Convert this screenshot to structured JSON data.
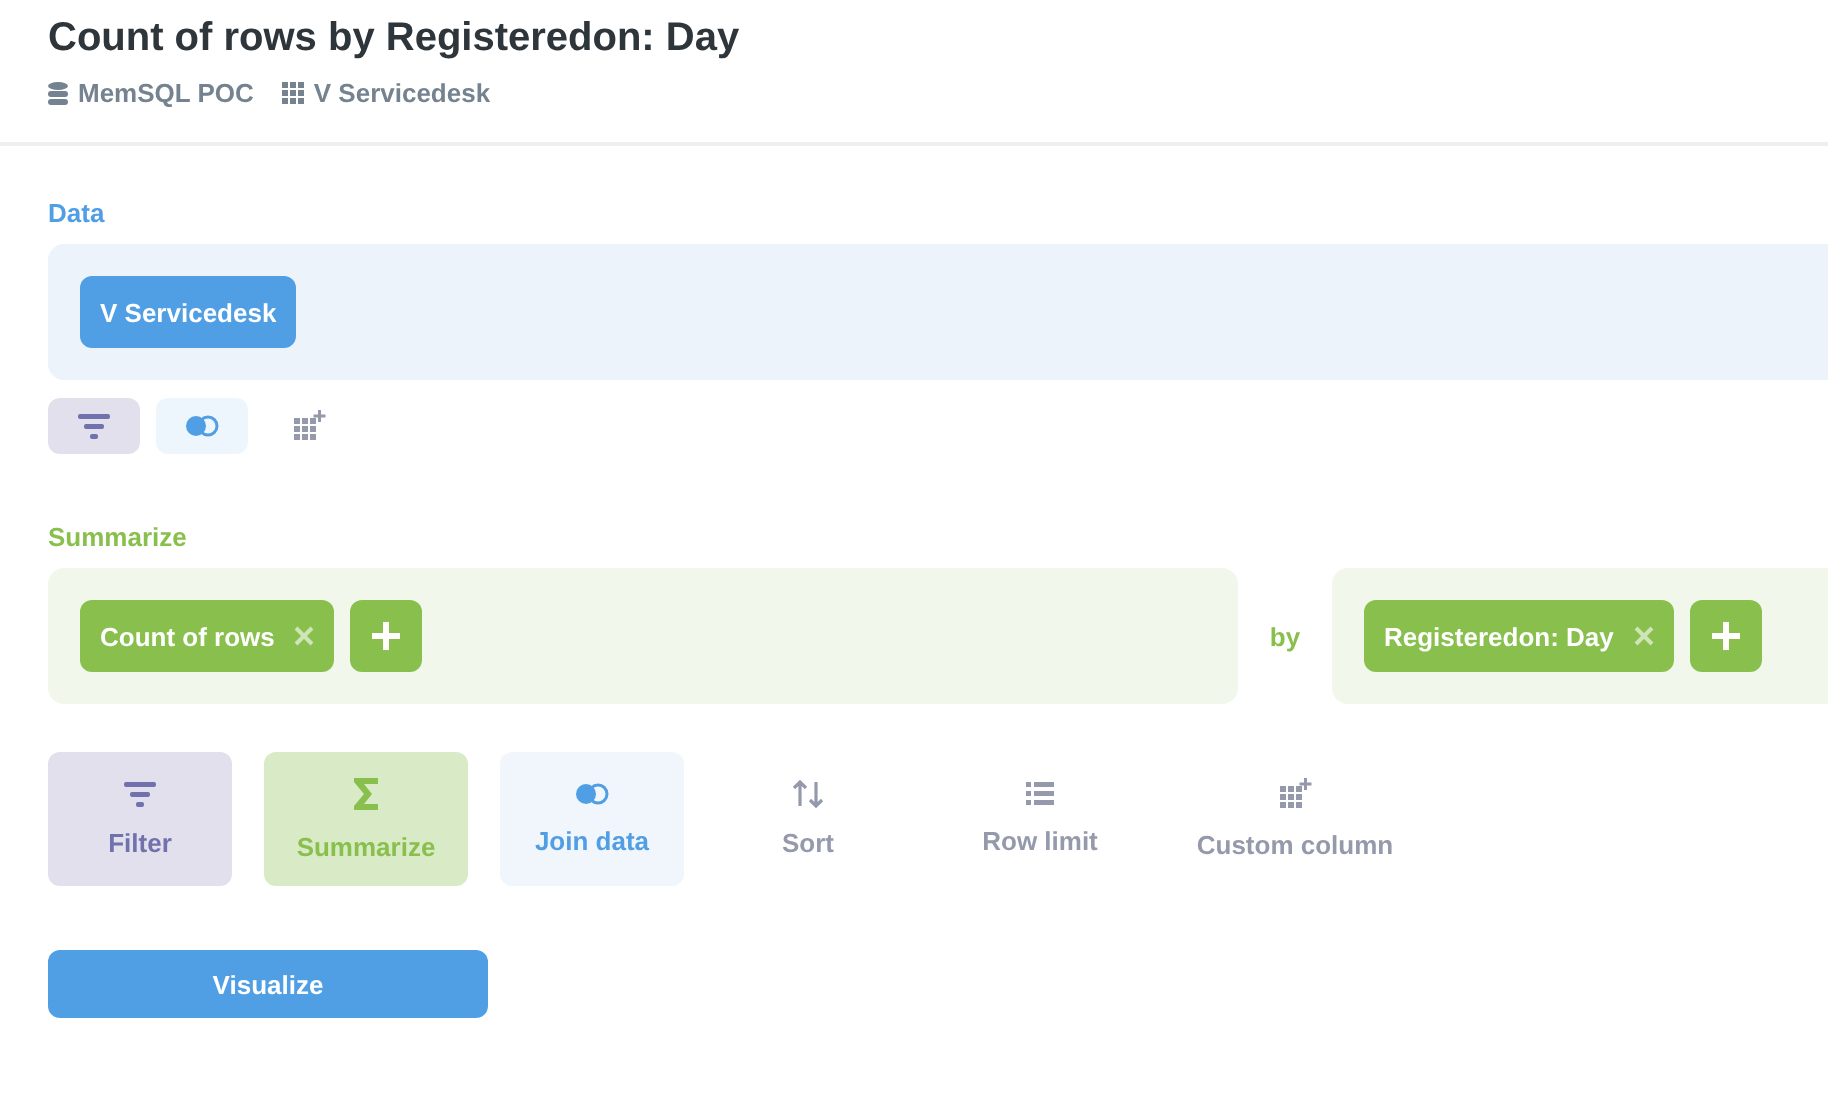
{
  "header": {
    "title": "Count of rows by Registeredon: Day",
    "breadcrumbs": [
      {
        "kind": "database",
        "label": "MemSQL POC"
      },
      {
        "kind": "table",
        "label": "V Servicedesk"
      }
    ]
  },
  "data_step": {
    "label": "Data",
    "source": "V Servicedesk",
    "tools": [
      {
        "kind": "filter"
      },
      {
        "kind": "join"
      },
      {
        "kind": "custom"
      }
    ]
  },
  "summarize_step": {
    "label": "Summarize",
    "metrics": [
      "Count of rows"
    ],
    "by_label": "by",
    "breakouts": [
      "Registeredon: Day"
    ]
  },
  "actions": [
    {
      "kind": "filter",
      "label": "Filter"
    },
    {
      "kind": "summarize",
      "label": "Summarize"
    },
    {
      "kind": "join",
      "label": "Join data"
    },
    {
      "kind": "sort",
      "label": "Sort"
    },
    {
      "kind": "limit",
      "label": "Row limit"
    },
    {
      "kind": "custom",
      "label": "Custom column"
    }
  ],
  "visualize_button": "Visualize"
}
